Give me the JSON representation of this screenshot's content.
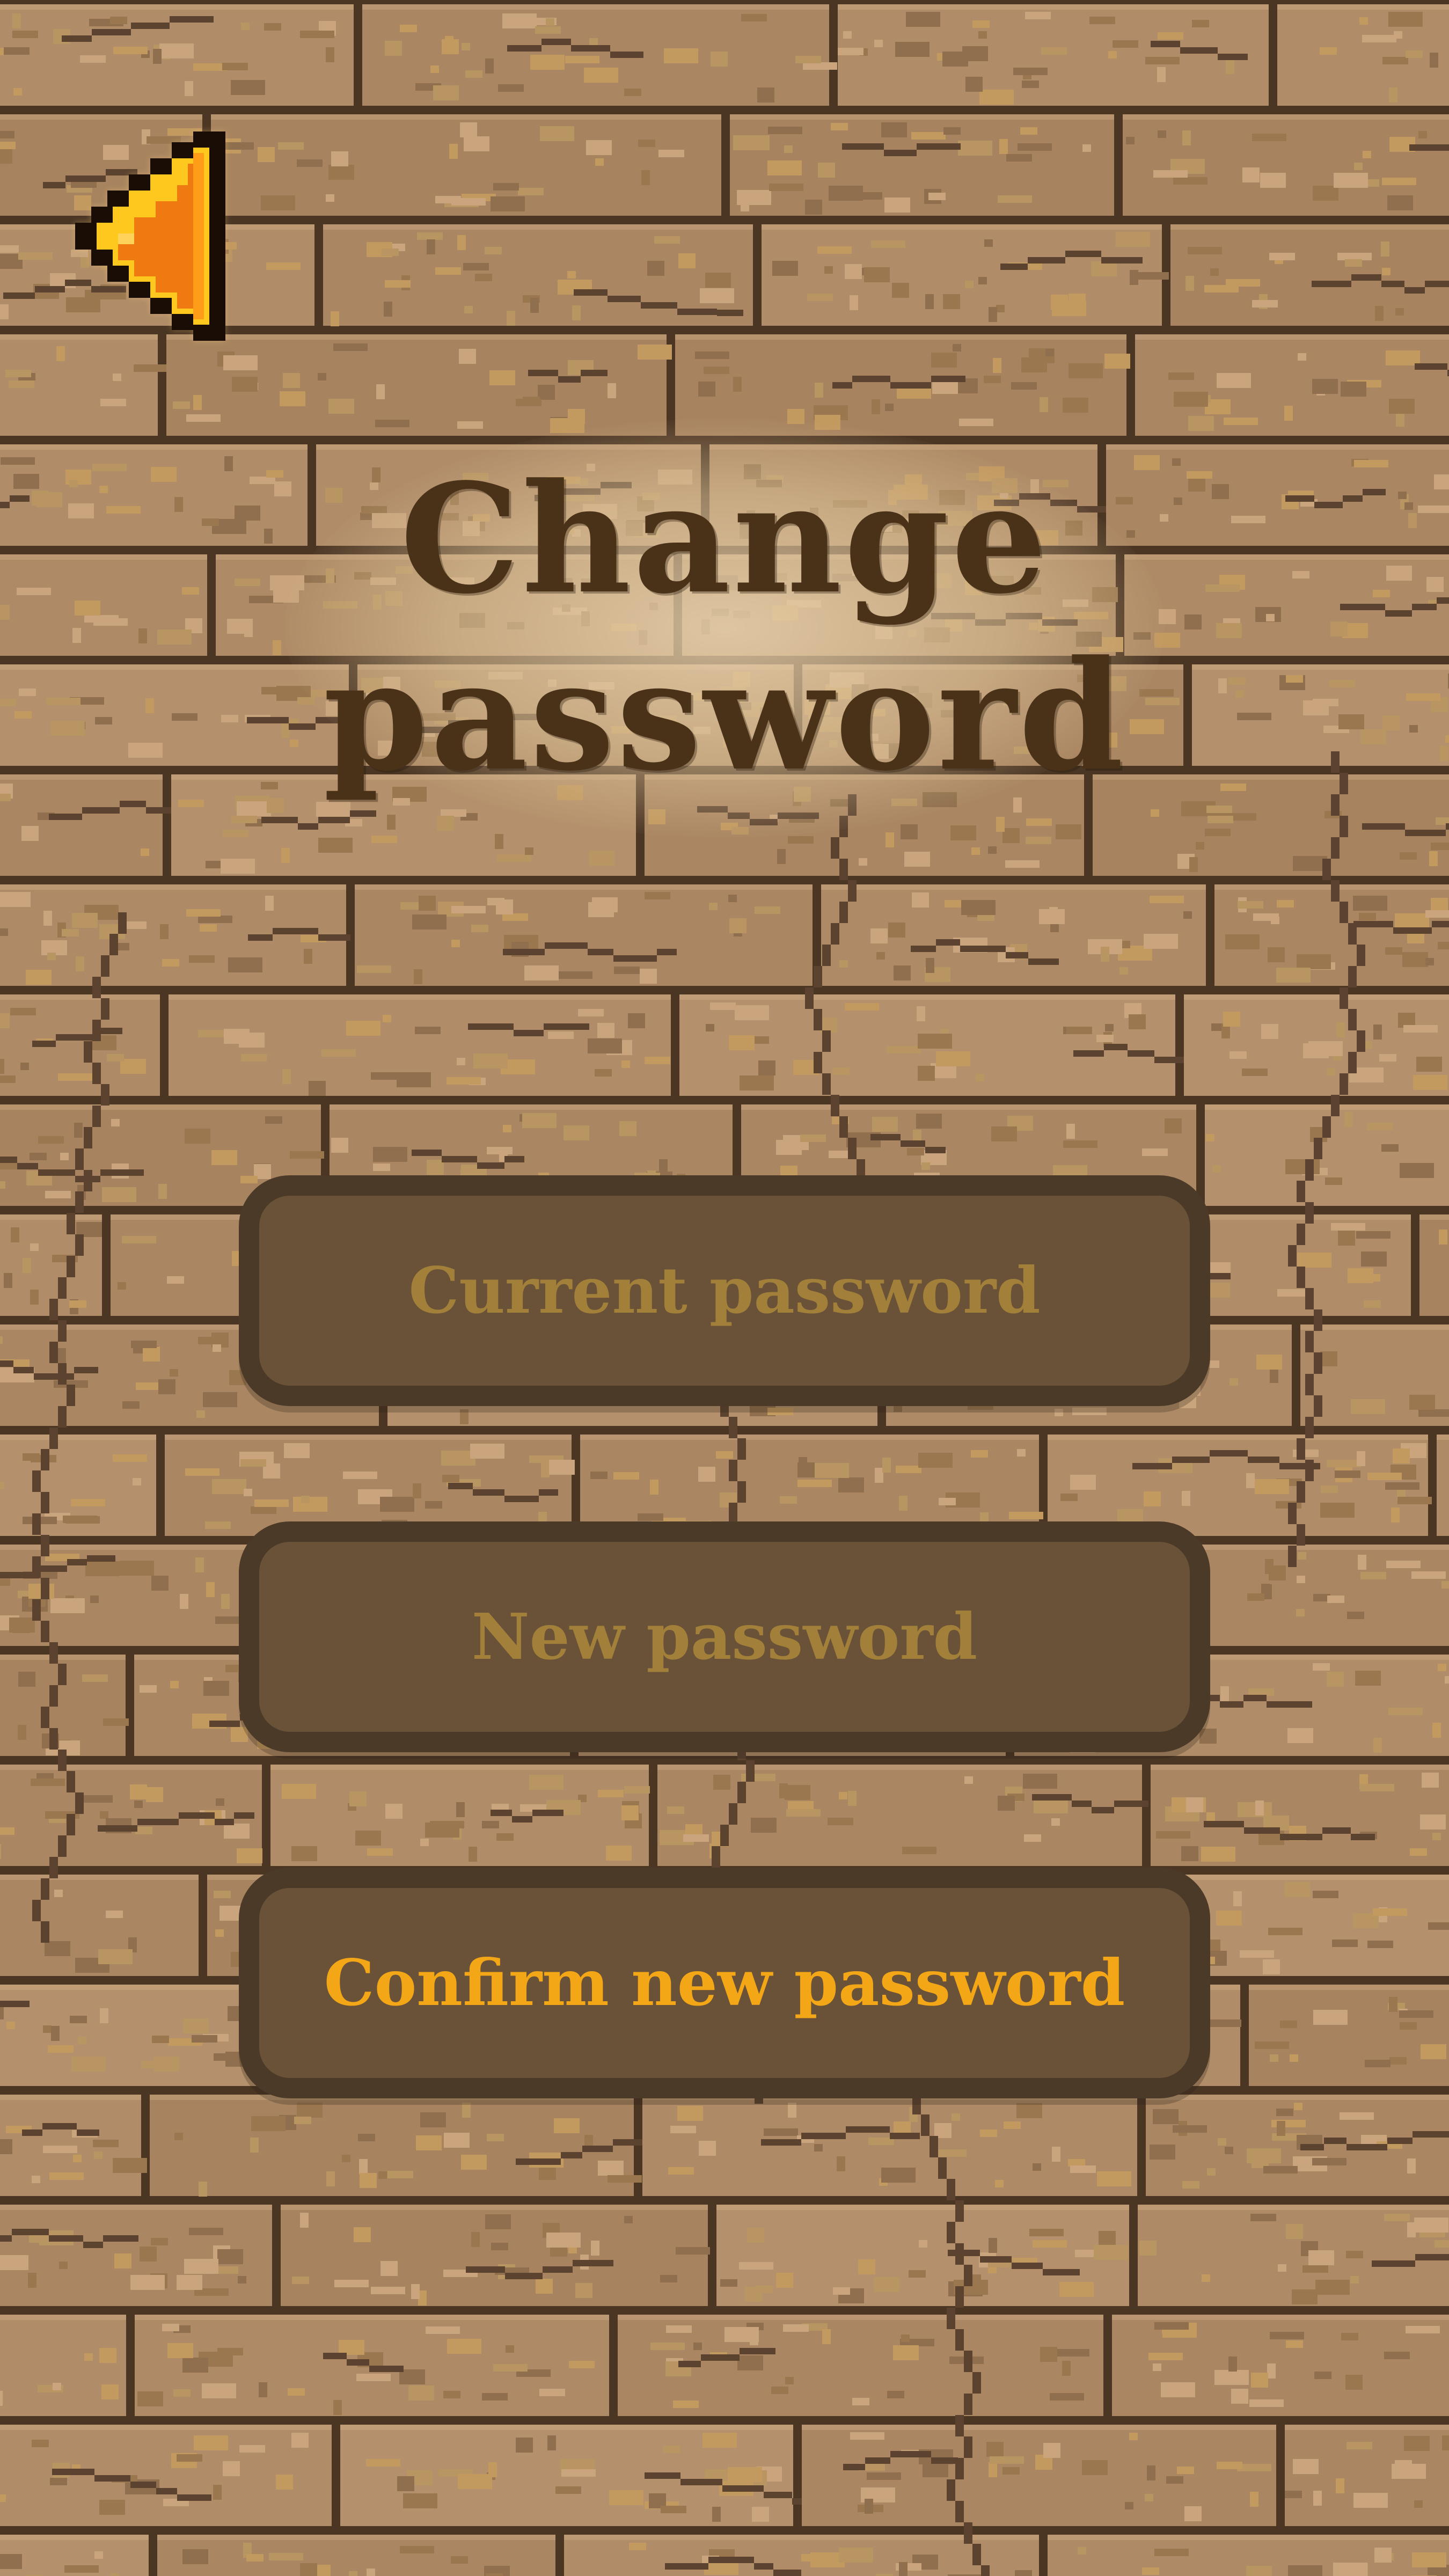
{
  "screen": {
    "title": "Change password"
  },
  "header": {
    "back_icon": "back-arrow-icon"
  },
  "form": {
    "fields": [
      {
        "label": "Current password",
        "active": false
      },
      {
        "label": "New password",
        "active": false
      },
      {
        "label": "Confirm new password",
        "active": true
      }
    ]
  },
  "colors": {
    "wall_brick": "#ad8a66",
    "wall_mortar": "#4b3624",
    "title_text": "#4a3219",
    "field_fill": "#6a5238",
    "field_border": "#4b3a28",
    "placeholder_text": "#a2803a",
    "active_text": "#f3a716",
    "back_arrow_orange": "#f07a12",
    "back_arrow_yellow": "#ffc81e"
  }
}
